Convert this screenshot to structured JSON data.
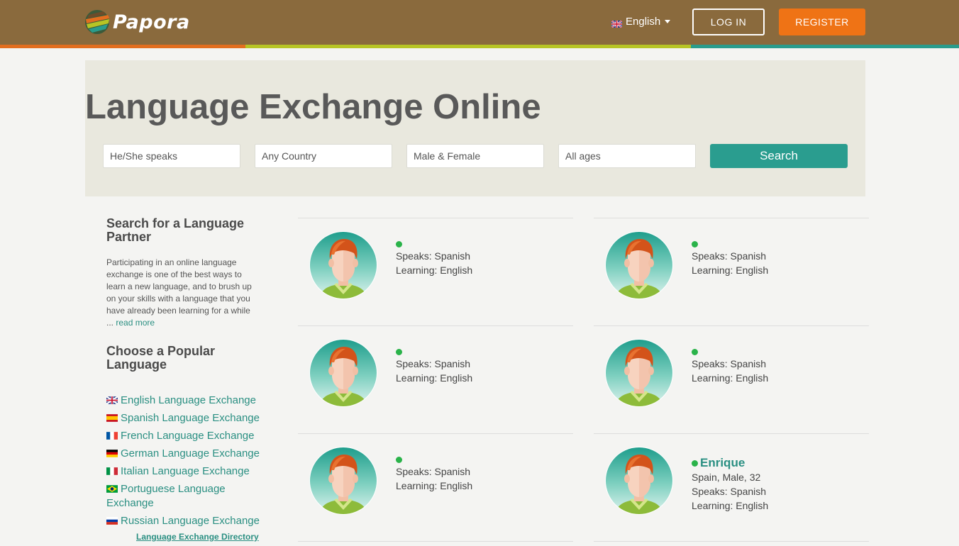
{
  "header": {
    "logo_text": "Papora",
    "language": "English",
    "login_label": "LOG IN",
    "register_label": "REGISTER",
    "colors": {
      "bar": "#8a6a3d",
      "stripe_orange": "#e26e1f",
      "stripe_green": "#b7c425",
      "stripe_teal": "#2a9c8c",
      "register": "#ef7315"
    }
  },
  "hero": {
    "title": "Language Exchange Online",
    "filters": {
      "speaks": "He/She speaks",
      "country": "Any Country",
      "gender": "Male & Female",
      "ages": "All ages"
    },
    "search_label": "Search"
  },
  "sidebar": {
    "heading1": "Search for a Language Partner",
    "intro": "Participating in an online language exchange is one of the best ways to learn a new language, and to brush up on your skills with a language that you have already been learning for a while ...",
    "read_more": "read more",
    "heading2": "Choose a Popular Language",
    "languages": [
      {
        "label": "English Language Exchange",
        "flag": "uk-flag-icon"
      },
      {
        "label": "Spanish Language Exchange",
        "flag": "spain-flag-icon"
      },
      {
        "label": "French Language Exchange",
        "flag": "france-flag-icon"
      },
      {
        "label": "German Language Exchange",
        "flag": "germany-flag-icon"
      },
      {
        "label": "Italian Language Exchange",
        "flag": "italy-flag-icon"
      },
      {
        "label": "Portuguese Language Exchange",
        "flag": "brazil-flag-icon"
      },
      {
        "label": "Russian Language Exchange",
        "flag": "russia-flag-icon"
      }
    ],
    "directory": "Language Exchange Directory"
  },
  "members": [
    {
      "name": "",
      "location": "",
      "speaks": "Speaks: Spanish",
      "learning": "Learning: English",
      "online": true
    },
    {
      "name": "",
      "location": "",
      "speaks": "Speaks: Spanish",
      "learning": "Learning: English",
      "online": true
    },
    {
      "name": "",
      "location": "",
      "speaks": "Speaks: Spanish",
      "learning": "Learning: English",
      "online": true
    },
    {
      "name": "",
      "location": "",
      "speaks": "Speaks: Spanish",
      "learning": "Learning: English",
      "online": true
    },
    {
      "name": "",
      "location": "",
      "speaks": "Speaks: Spanish",
      "learning": "Learning: English",
      "online": true
    },
    {
      "name": "Enrique",
      "location": "Spain, Male, 32",
      "speaks": "Speaks: Spanish",
      "learning": "Learning: English",
      "online": true
    }
  ]
}
